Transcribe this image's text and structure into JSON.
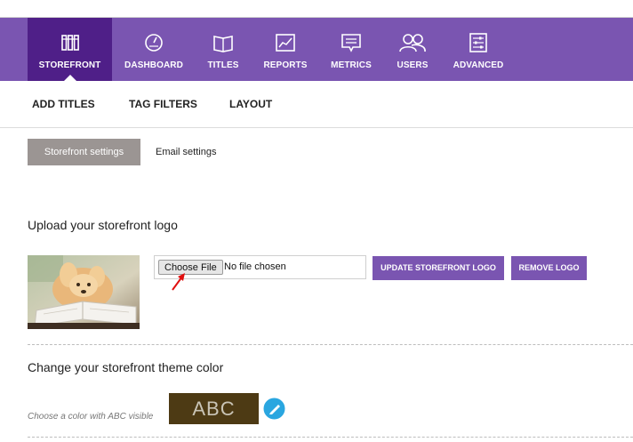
{
  "nav": {
    "items": [
      {
        "label": "STOREFRONT",
        "icon": "books-icon"
      },
      {
        "label": "DASHBOARD",
        "icon": "gauge-icon"
      },
      {
        "label": "TITLES",
        "icon": "open-book-icon"
      },
      {
        "label": "REPORTS",
        "icon": "line-chart-icon"
      },
      {
        "label": "METRICS",
        "icon": "message-box-icon"
      },
      {
        "label": "USERS",
        "icon": "users-icon"
      },
      {
        "label": "ADVANCED",
        "icon": "sliders-icon"
      }
    ],
    "active": "STOREFRONT"
  },
  "subnav": {
    "tabs": [
      "ADD TITLES",
      "TAG FILTERS",
      "LAYOUT"
    ]
  },
  "settings_tabs": {
    "active": "Storefront settings",
    "other": "Email settings"
  },
  "logo_section": {
    "title": "Upload your storefront logo",
    "choose_file_label": "Choose File",
    "file_status": "No file chosen",
    "update_button": "UPDATE STOREFRONT LOGO",
    "remove_button": "REMOVE LOGO"
  },
  "theme_section": {
    "title": "Change your storefront theme color",
    "hint": "Choose a color with ABC visible",
    "swatch_text": "ABC",
    "swatch_color": "#4d3a14"
  },
  "colors": {
    "nav_bg": "#7a55b1",
    "nav_active": "#4f1f88",
    "button_purple": "#7a55b1",
    "picker_blue": "#2aa6e0"
  }
}
